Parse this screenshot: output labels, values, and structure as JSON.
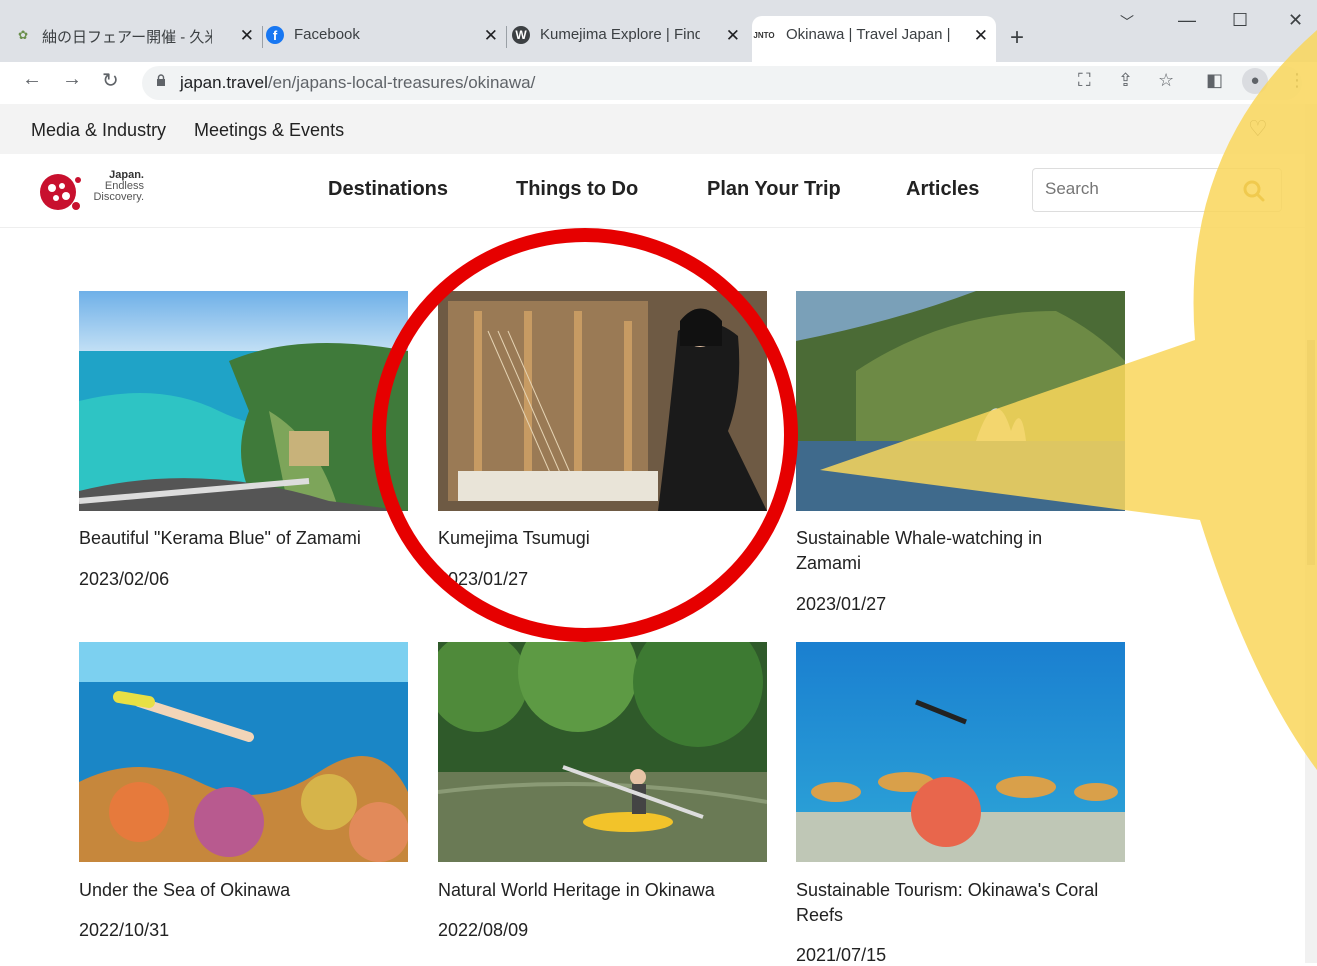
{
  "browser": {
    "tabs": [
      {
        "title": "紬の日フェアー開催 - 久米島",
        "icon": "site-icon"
      },
      {
        "title": "Facebook",
        "icon": "facebook-icon"
      },
      {
        "title": "Kumejima Explore | Find",
        "icon": "wordpress-icon"
      },
      {
        "title": "Okinawa | Travel Japan | J",
        "icon": "jnto-icon",
        "active": true
      }
    ],
    "jnto_label": "JNTO",
    "url_host": "japan.travel",
    "url_path": "/en/japans-local-treasures/okinawa/"
  },
  "site": {
    "top_links": [
      "Media & Industry",
      "Meetings & Events"
    ],
    "logo": {
      "line1": "Japan.",
      "line2": "Endless",
      "line3": "Discovery."
    },
    "nav": [
      "Destinations",
      "Things to Do",
      "Plan Your Trip",
      "Articles"
    ],
    "search_placeholder": "Search"
  },
  "cards": [
    {
      "title": "Beautiful \"Kerama Blue\" of Zamami",
      "date": "2023/02/06"
    },
    {
      "title": "Kumejima Tsumugi",
      "date": "2023/01/27"
    },
    {
      "title": "Sustainable Whale-watching in Zamami",
      "date": "2023/01/27"
    },
    {
      "title": "Under the Sea of Okinawa",
      "date": "2022/10/31"
    },
    {
      "title": "Natural World Heritage in Okinawa",
      "date": "2022/08/09"
    },
    {
      "title": "Sustainable Tourism: Okinawa's Coral Reefs",
      "date": "2021/07/15"
    }
  ],
  "colors": {
    "highlight_circle": "#e60000",
    "callout": "#f9d65a"
  }
}
